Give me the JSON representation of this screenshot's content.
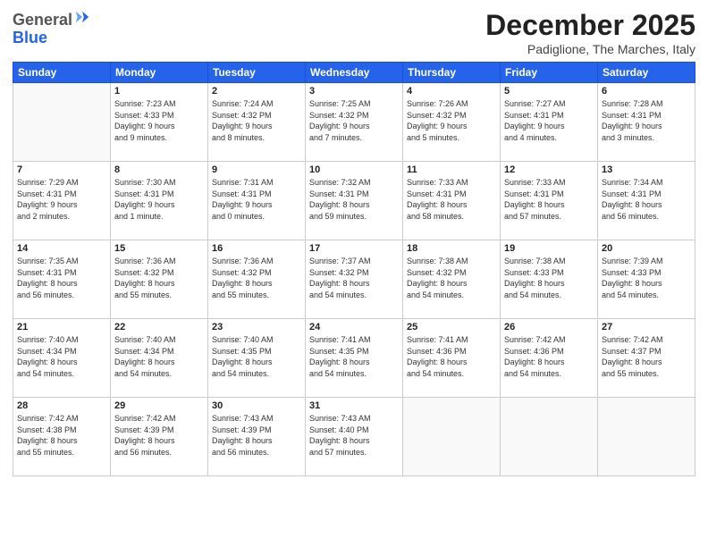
{
  "header": {
    "logo_general": "General",
    "logo_blue": "Blue",
    "month_title": "December 2025",
    "location": "Padiglione, The Marches, Italy"
  },
  "weekdays": [
    "Sunday",
    "Monday",
    "Tuesday",
    "Wednesday",
    "Thursday",
    "Friday",
    "Saturday"
  ],
  "weeks": [
    [
      {
        "day": "",
        "info": ""
      },
      {
        "day": "1",
        "info": "Sunrise: 7:23 AM\nSunset: 4:33 PM\nDaylight: 9 hours\nand 9 minutes."
      },
      {
        "day": "2",
        "info": "Sunrise: 7:24 AM\nSunset: 4:32 PM\nDaylight: 9 hours\nand 8 minutes."
      },
      {
        "day": "3",
        "info": "Sunrise: 7:25 AM\nSunset: 4:32 PM\nDaylight: 9 hours\nand 7 minutes."
      },
      {
        "day": "4",
        "info": "Sunrise: 7:26 AM\nSunset: 4:32 PM\nDaylight: 9 hours\nand 5 minutes."
      },
      {
        "day": "5",
        "info": "Sunrise: 7:27 AM\nSunset: 4:31 PM\nDaylight: 9 hours\nand 4 minutes."
      },
      {
        "day": "6",
        "info": "Sunrise: 7:28 AM\nSunset: 4:31 PM\nDaylight: 9 hours\nand 3 minutes."
      }
    ],
    [
      {
        "day": "7",
        "info": "Sunrise: 7:29 AM\nSunset: 4:31 PM\nDaylight: 9 hours\nand 2 minutes."
      },
      {
        "day": "8",
        "info": "Sunrise: 7:30 AM\nSunset: 4:31 PM\nDaylight: 9 hours\nand 1 minute."
      },
      {
        "day": "9",
        "info": "Sunrise: 7:31 AM\nSunset: 4:31 PM\nDaylight: 9 hours\nand 0 minutes."
      },
      {
        "day": "10",
        "info": "Sunrise: 7:32 AM\nSunset: 4:31 PM\nDaylight: 8 hours\nand 59 minutes."
      },
      {
        "day": "11",
        "info": "Sunrise: 7:33 AM\nSunset: 4:31 PM\nDaylight: 8 hours\nand 58 minutes."
      },
      {
        "day": "12",
        "info": "Sunrise: 7:33 AM\nSunset: 4:31 PM\nDaylight: 8 hours\nand 57 minutes."
      },
      {
        "day": "13",
        "info": "Sunrise: 7:34 AM\nSunset: 4:31 PM\nDaylight: 8 hours\nand 56 minutes."
      }
    ],
    [
      {
        "day": "14",
        "info": "Sunrise: 7:35 AM\nSunset: 4:31 PM\nDaylight: 8 hours\nand 56 minutes."
      },
      {
        "day": "15",
        "info": "Sunrise: 7:36 AM\nSunset: 4:32 PM\nDaylight: 8 hours\nand 55 minutes."
      },
      {
        "day": "16",
        "info": "Sunrise: 7:36 AM\nSunset: 4:32 PM\nDaylight: 8 hours\nand 55 minutes."
      },
      {
        "day": "17",
        "info": "Sunrise: 7:37 AM\nSunset: 4:32 PM\nDaylight: 8 hours\nand 54 minutes."
      },
      {
        "day": "18",
        "info": "Sunrise: 7:38 AM\nSunset: 4:32 PM\nDaylight: 8 hours\nand 54 minutes."
      },
      {
        "day": "19",
        "info": "Sunrise: 7:38 AM\nSunset: 4:33 PM\nDaylight: 8 hours\nand 54 minutes."
      },
      {
        "day": "20",
        "info": "Sunrise: 7:39 AM\nSunset: 4:33 PM\nDaylight: 8 hours\nand 54 minutes."
      }
    ],
    [
      {
        "day": "21",
        "info": "Sunrise: 7:40 AM\nSunset: 4:34 PM\nDaylight: 8 hours\nand 54 minutes."
      },
      {
        "day": "22",
        "info": "Sunrise: 7:40 AM\nSunset: 4:34 PM\nDaylight: 8 hours\nand 54 minutes."
      },
      {
        "day": "23",
        "info": "Sunrise: 7:40 AM\nSunset: 4:35 PM\nDaylight: 8 hours\nand 54 minutes."
      },
      {
        "day": "24",
        "info": "Sunrise: 7:41 AM\nSunset: 4:35 PM\nDaylight: 8 hours\nand 54 minutes."
      },
      {
        "day": "25",
        "info": "Sunrise: 7:41 AM\nSunset: 4:36 PM\nDaylight: 8 hours\nand 54 minutes."
      },
      {
        "day": "26",
        "info": "Sunrise: 7:42 AM\nSunset: 4:36 PM\nDaylight: 8 hours\nand 54 minutes."
      },
      {
        "day": "27",
        "info": "Sunrise: 7:42 AM\nSunset: 4:37 PM\nDaylight: 8 hours\nand 55 minutes."
      }
    ],
    [
      {
        "day": "28",
        "info": "Sunrise: 7:42 AM\nSunset: 4:38 PM\nDaylight: 8 hours\nand 55 minutes."
      },
      {
        "day": "29",
        "info": "Sunrise: 7:42 AM\nSunset: 4:39 PM\nDaylight: 8 hours\nand 56 minutes."
      },
      {
        "day": "30",
        "info": "Sunrise: 7:43 AM\nSunset: 4:39 PM\nDaylight: 8 hours\nand 56 minutes."
      },
      {
        "day": "31",
        "info": "Sunrise: 7:43 AM\nSunset: 4:40 PM\nDaylight: 8 hours\nand 57 minutes."
      },
      {
        "day": "",
        "info": ""
      },
      {
        "day": "",
        "info": ""
      },
      {
        "day": "",
        "info": ""
      }
    ]
  ]
}
